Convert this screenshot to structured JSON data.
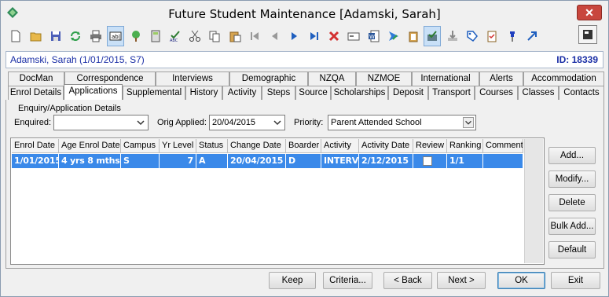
{
  "window": {
    "title": "Future Student Maintenance  [Adamski, Sarah]",
    "close_label": "✕"
  },
  "toolbar": {
    "icons": [
      "new-document-icon",
      "open-folder-icon",
      "save-icon",
      "refresh-icon",
      "print-icon",
      "text-field-icon",
      "tree-icon",
      "calculator-icon",
      "spellcheck-icon",
      "cut-icon",
      "copy-icon",
      "paste-icon",
      "first-record-icon",
      "previous-record-icon",
      "next-record-icon",
      "last-record-icon",
      "delete-icon",
      "card-icon",
      "word-document-icon",
      "send-icon",
      "clipboard-icon",
      "approve-icon",
      "download-icon",
      "tag-icon",
      "checklist-icon",
      "pin-icon",
      "arrow-icon"
    ],
    "right_icon": "exit-window-icon"
  },
  "info": {
    "name": "Adamski, Sarah (1/01/2015, S7)",
    "id": "ID: 18339"
  },
  "tabs_row1": [
    "DocMan",
    "Correspondence",
    "Interviews",
    "Demographic",
    "NZQA",
    "NZMOE",
    "International",
    "Alerts",
    "Accommodation"
  ],
  "tabs_row2": [
    "Enrol Details",
    "Applications",
    "Supplemental",
    "History",
    "Activity",
    "Steps",
    "Source",
    "Scholarships",
    "Deposit",
    "Transport",
    "Courses",
    "Classes",
    "Contacts"
  ],
  "active_tab": "Applications",
  "group": {
    "title": "Enquiry/Application Details",
    "enquired_label": "Enquired:",
    "enquired_value": "",
    "orig_applied_label": "Orig Applied:",
    "orig_applied_value": "20/04/2015",
    "priority_label": "Priority:",
    "priority_value": "Parent Attended School"
  },
  "grid": {
    "headers": [
      "Enrol Date",
      "Age Enrol Date",
      "Campus",
      "Yr Level",
      "Status",
      "Change Date",
      "Boarder",
      "Activity",
      "Activity Date",
      "Review",
      "Ranking",
      "Comment"
    ],
    "rows": [
      {
        "enrol_date": "1/01/2015",
        "age": "4 yrs 8 mths",
        "campus": "S",
        "yr_level": "7",
        "status": "A",
        "change_date": "20/04/2015",
        "boarder": "D",
        "activity": "INTERVIEW",
        "activity_date": "2/12/2015",
        "review": false,
        "ranking": "1/1",
        "comment": ""
      }
    ]
  },
  "side_buttons": {
    "add": "Add...",
    "modify": "Modify...",
    "delete": "Delete",
    "bulk_add": "Bulk Add...",
    "default": "Default"
  },
  "bottom_buttons": {
    "keep": "Keep",
    "criteria": "Criteria...",
    "back": "< Back",
    "next": "Next >",
    "ok": "OK",
    "exit": "Exit"
  },
  "colors": {
    "selection": "#3a89e9",
    "info_text": "#1b2fa6",
    "close": "#c8463d"
  }
}
